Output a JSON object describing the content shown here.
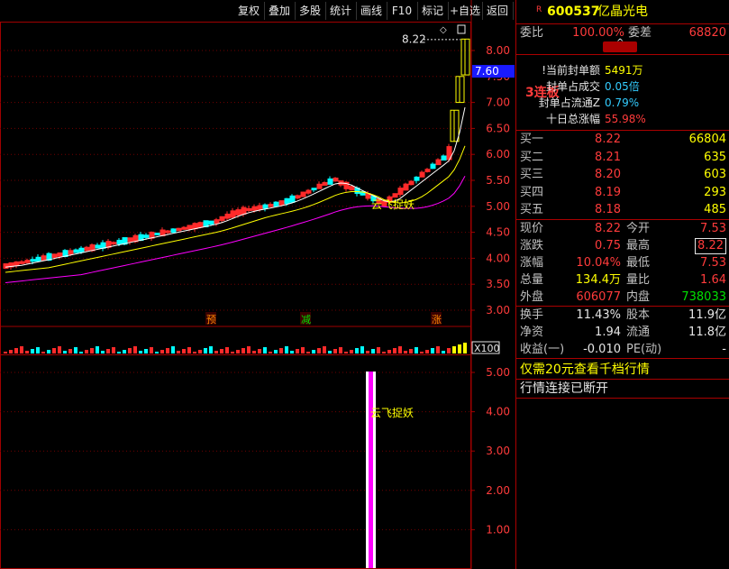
{
  "toolbar": {
    "buttons": [
      "复权",
      "叠加",
      "多股",
      "统计",
      "画线",
      "F10",
      "标记",
      "+自选",
      "返回"
    ]
  },
  "main_chart": {
    "price_ticks": [
      "8.00",
      "7.50",
      "7.00",
      "6.50",
      "6.00",
      "5.50",
      "5.00",
      "4.50",
      "4.00",
      "3.50",
      "3.00"
    ],
    "current_price_tag": "7.60",
    "high_label": "8.22",
    "annotation": "云飞捉妖",
    "markers": [
      "预",
      "减",
      "涨"
    ],
    "colors": {
      "up": "#ff2a2a",
      "down": "#00ffff",
      "ma1": "#ffffff",
      "ma2": "#ffff00",
      "ma3": "#ff00ff",
      "grid": "#a00000"
    }
  },
  "volume": {
    "scale_label": "X100"
  },
  "indicator": {
    "ticks": [
      "5.00",
      "4.00",
      "3.00",
      "2.00",
      "1.00"
    ],
    "annotation": "云飞捉妖"
  },
  "quote": {
    "badge": "R",
    "code": "600537",
    "name": "亿晶光电",
    "weibi_label": "委比",
    "weibi_value": "100.00%",
    "weicha_label": "委差",
    "weicha_value": "68820",
    "board_label": "3连板",
    "seal_info": [
      {
        "label": "!当前封单额",
        "value": "5491万"
      },
      {
        "label": "封单占成交",
        "value": "0.05倍"
      },
      {
        "label": "封单占流通Z",
        "value": "0.79%"
      },
      {
        "label": "十日总涨幅",
        "value": "55.98%"
      }
    ],
    "bids": [
      {
        "label": "买一",
        "price": "8.22",
        "vol": "66804"
      },
      {
        "label": "买二",
        "price": "8.21",
        "vol": "635"
      },
      {
        "label": "买三",
        "price": "8.20",
        "vol": "603"
      },
      {
        "label": "买四",
        "price": "8.19",
        "vol": "293"
      },
      {
        "label": "买五",
        "price": "8.18",
        "vol": "485"
      }
    ],
    "stats": [
      {
        "l1": "现价",
        "v1": "8.22",
        "l2": "今开",
        "v2": "7.53"
      },
      {
        "l1": "涨跌",
        "v1": "0.75",
        "l2": "最高",
        "v2": "8.22"
      },
      {
        "l1": "涨幅",
        "v1": "10.04%",
        "l2": "最低",
        "v2": "7.53"
      },
      {
        "l1": "总量",
        "v1": "134.4万",
        "l2": "量比",
        "v2": "1.64"
      },
      {
        "l1": "外盘",
        "v1": "606077",
        "l2": "内盘",
        "v2": "738033"
      }
    ],
    "fund": [
      {
        "l1": "换手",
        "v1": "11.43%",
        "l2": "股本",
        "v2": "11.9亿"
      },
      {
        "l1": "净资",
        "v1": "1.94",
        "l2": "流通",
        "v2": "11.8亿"
      },
      {
        "l1": "收益(一)",
        "v1": "-0.010",
        "l2": "PE(动)",
        "v2": "-"
      }
    ],
    "promo": "仅需20元查看千档行情",
    "status": "行情连接已断开"
  }
}
